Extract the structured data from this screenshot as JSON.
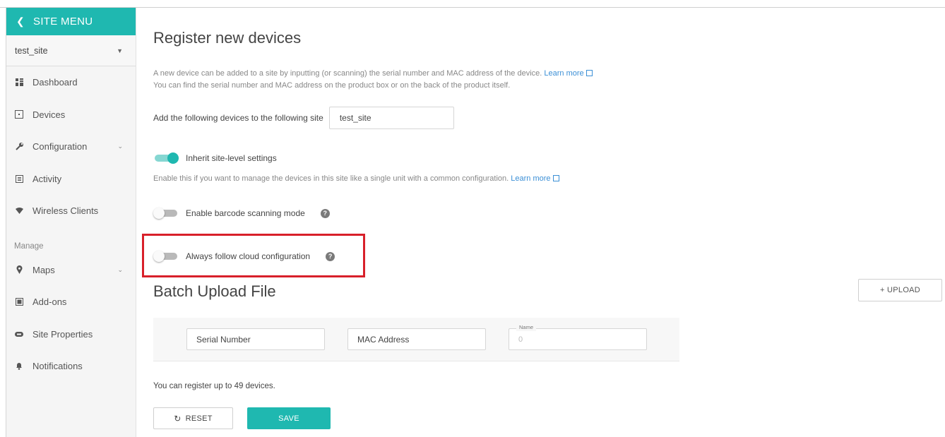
{
  "sidebar": {
    "header": "SITE MENU",
    "site": "test_site",
    "items": [
      {
        "label": "Dashboard",
        "icon": "dashboard-icon"
      },
      {
        "label": "Devices",
        "icon": "devices-icon"
      },
      {
        "label": "Configuration",
        "icon": "wrench-icon"
      },
      {
        "label": "Activity",
        "icon": "activity-icon"
      },
      {
        "label": "Wireless Clients",
        "icon": "wifi-icon"
      }
    ],
    "manage_section": "Manage",
    "manage_items": [
      {
        "label": "Maps",
        "icon": "map-pin-icon"
      },
      {
        "label": "Add-ons",
        "icon": "addons-icon"
      },
      {
        "label": "Site Properties",
        "icon": "link-icon"
      },
      {
        "label": "Notifications",
        "icon": "bell-icon"
      }
    ]
  },
  "main": {
    "title": "Register new devices",
    "intro_line1": "A new device can be added to a site by inputting (or scanning) the serial number and MAC address of the device.",
    "learn_more": "Learn more",
    "intro_line2": "You can find the serial number and MAC address on the product box or on the back of the product itself.",
    "add_label": "Add the following devices to the following site",
    "site_value": "test_site",
    "inherit_label": "Inherit site-level settings",
    "inherit_on": true,
    "inherit_desc": "Enable this if you want to manage the devices in this site like a single unit with a common configuration.",
    "barcode_label": "Enable barcode scanning mode",
    "barcode_on": false,
    "cloud_label": "Always follow cloud configuration",
    "cloud_on": false,
    "batch_title": "Batch Upload File",
    "upload_label": "+ UPLOAD",
    "serial_placeholder": "Serial Number",
    "mac_placeholder": "MAC Address",
    "name_label": "Name",
    "name_value": "0",
    "limit_text": "You can register up to 49 devices.",
    "reset_label": "RESET",
    "save_label": "SAVE"
  },
  "colors": {
    "accent": "#1fb8b0",
    "link": "#3b8fd6",
    "highlight": "#d8202a"
  }
}
